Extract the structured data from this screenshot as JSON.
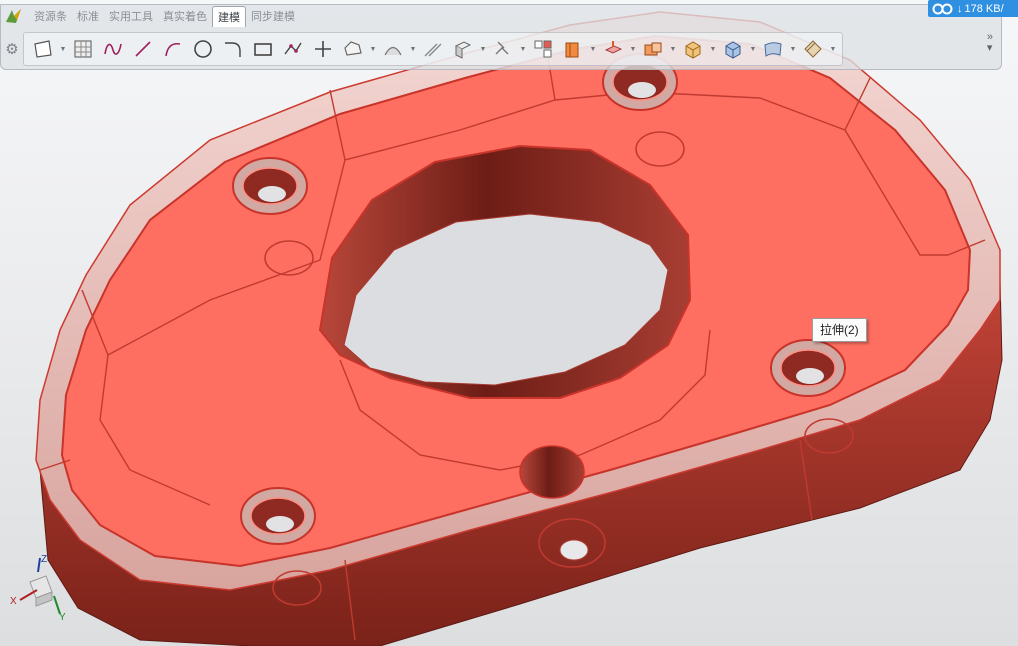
{
  "ribbon": {
    "tabs": [
      {
        "label": "资源条",
        "active": false
      },
      {
        "label": "标准",
        "active": false
      },
      {
        "label": "实用工具",
        "active": false
      },
      {
        "label": "真实着色",
        "active": false
      },
      {
        "label": "建模",
        "active": true
      },
      {
        "label": "同步建模",
        "active": false
      }
    ],
    "more_label": "»"
  },
  "tools": [
    "sketch-rectangle-icon",
    "hatch-grid-icon",
    "studio-spline-icon",
    "line-icon",
    "arc-icon",
    "circle-icon",
    "fillet-icon",
    "rectangle-icon",
    "polyline-icon",
    "point-icon",
    "polygon-icon",
    "derived-curve-icon",
    "offset-curve-icon",
    "extrude-icon",
    "revolve-icon",
    "datum-icon",
    "pattern-icon",
    "shell-icon",
    "blend-icon",
    "chamfer-icon",
    "union-icon",
    "subtract-icon",
    "intersect-icon",
    "surface-icon",
    "trim-body-icon"
  ],
  "speed_badge": {
    "arrow": "↓",
    "text": "178 KB/"
  },
  "tooltip": {
    "text": "拉伸(2)"
  },
  "triad": {
    "z": "Z",
    "x": "X",
    "y": "Y"
  },
  "colors": {
    "part_face": "#ff6f61",
    "part_edge": "#c8332a",
    "part_side": "#9c2c22",
    "highlight": "#f0e8e6",
    "badge": "#2f8fe0"
  }
}
